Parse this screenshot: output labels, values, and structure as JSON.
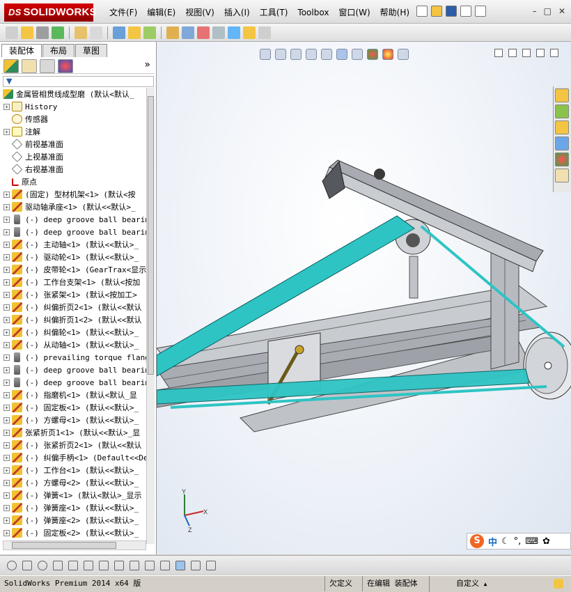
{
  "app": {
    "brand": "SOLIDWORKS",
    "brand_prefix": "DS"
  },
  "menu": [
    "文件(F)",
    "编辑(E)",
    "视图(V)",
    "插入(I)",
    "工具(T)",
    "Toolbox",
    "窗口(W)",
    "帮助(H)"
  ],
  "window_controls": [
    "–",
    "□",
    "✕"
  ],
  "panel": {
    "tabs": [
      "装配体",
      "布局",
      "草图"
    ],
    "more": "»",
    "filter_icon": "funnel-icon"
  },
  "tree": {
    "root": "金属管相贯线成型磨  (默认<默认_",
    "items": [
      {
        "label": "History",
        "icon": "history-icon",
        "expand": true
      },
      {
        "label": "传感器",
        "icon": "sensor-icon",
        "expand": false
      },
      {
        "label": "注解",
        "icon": "annotation-icon",
        "expand": true
      },
      {
        "label": "前视基准面",
        "icon": "plane-icon",
        "expand": false
      },
      {
        "label": "上视基准面",
        "icon": "plane-icon",
        "expand": false
      },
      {
        "label": "右视基准面",
        "icon": "plane-icon",
        "expand": false
      },
      {
        "label": "原点",
        "icon": "origin-icon",
        "expand": false
      },
      {
        "label": "(固定) 型材机架<1> (默认<按",
        "icon": "assembly-icon",
        "expand": true
      },
      {
        "label": "驱动轴承座<1> (默认<<默认>_",
        "icon": "assembly-icon",
        "expand": true
      },
      {
        "label": "(-) deep groove ball bearing",
        "icon": "part-icon",
        "expand": true
      },
      {
        "label": "(-) deep groove ball bearing",
        "icon": "part-icon",
        "expand": true
      },
      {
        "label": "(-) 主动轴<1> (默认<<默认>_",
        "icon": "assembly-icon",
        "expand": true
      },
      {
        "label": "(-) 驱动轮<1> (默认<<默认>_",
        "icon": "assembly-icon",
        "expand": true
      },
      {
        "label": "(-) 皮带轮<1> (GearTrax<显示",
        "icon": "assembly-icon",
        "expand": true
      },
      {
        "label": "(-) 工作台支架<1> (默认<按加",
        "icon": "assembly-icon",
        "expand": true
      },
      {
        "label": "(-) 张紧架<1> (默认<按加工>",
        "icon": "assembly-icon",
        "expand": true
      },
      {
        "label": "(-) 纠偏折页2<1> (默认<<默认",
        "icon": "assembly-icon",
        "expand": true
      },
      {
        "label": "(-) 纠偏折页1<2> (默认<<默认",
        "icon": "assembly-icon",
        "expand": true
      },
      {
        "label": "(-) 纠偏轮<1> (默认<<默认>_",
        "icon": "assembly-icon",
        "expand": true
      },
      {
        "label": "(-) 从动轴<1> (默认<<默认>_",
        "icon": "assembly-icon",
        "expand": true
      },
      {
        "label": "(-) prevailing torque flange",
        "icon": "part-icon",
        "expand": true
      },
      {
        "label": "(-) deep groove ball bearing",
        "icon": "part-icon",
        "expand": true
      },
      {
        "label": "(-) deep groove ball bearing",
        "icon": "part-icon",
        "expand": true
      },
      {
        "label": "(-) 指磨机<1> (默认<默认_显",
        "icon": "assembly-icon",
        "expand": true
      },
      {
        "label": "(-) 固定板<1> (默认<<默认>_",
        "icon": "assembly-icon",
        "expand": true
      },
      {
        "label": "(-) 方螺母<1> (默认<<默认>_",
        "icon": "assembly-icon",
        "expand": true
      },
      {
        "label": "张紧折页1<1> (默认<<默认>_显",
        "icon": "assembly-icon",
        "expand": true
      },
      {
        "label": "(-) 张紧折页2<1> (默认<<默认",
        "icon": "assembly-icon",
        "expand": true
      },
      {
        "label": "(-) 纠偏手柄<1> (Default<<De",
        "icon": "assembly-icon",
        "expand": true
      },
      {
        "label": "(-) 工作台<1> (默认<<默认>_",
        "icon": "assembly-icon",
        "expand": true
      },
      {
        "label": "(-) 方螺母<2> (默认<<默认>_",
        "icon": "assembly-icon",
        "expand": true
      },
      {
        "label": "(-) 弹簧<1> (默认<默认>_显示",
        "icon": "assembly-icon",
        "expand": true
      },
      {
        "label": "(-) 弹簧座<1> (默认<<默认>_",
        "icon": "assembly-icon",
        "expand": true
      },
      {
        "label": "(-) 弹簧座<2> (默认<<默认>_",
        "icon": "assembly-icon",
        "expand": true
      },
      {
        "label": "(-) 固定板<2> (默认<<默认>_",
        "icon": "assembly-icon",
        "expand": true
      }
    ]
  },
  "triad": {
    "x": "X",
    "y": "Y",
    "z": "Z"
  },
  "ime": {
    "logo": "S",
    "mode": "中"
  },
  "status": {
    "product": "SolidWorks Premium 2014 x64 版",
    "under_defined": "欠定义",
    "editing": "在编辑 装配体",
    "units": "自定义",
    "units_arrow": "▲"
  },
  "colors": {
    "belt": "#2ec4c4",
    "frame": "#b9bcc2",
    "brand": "#c00000"
  }
}
